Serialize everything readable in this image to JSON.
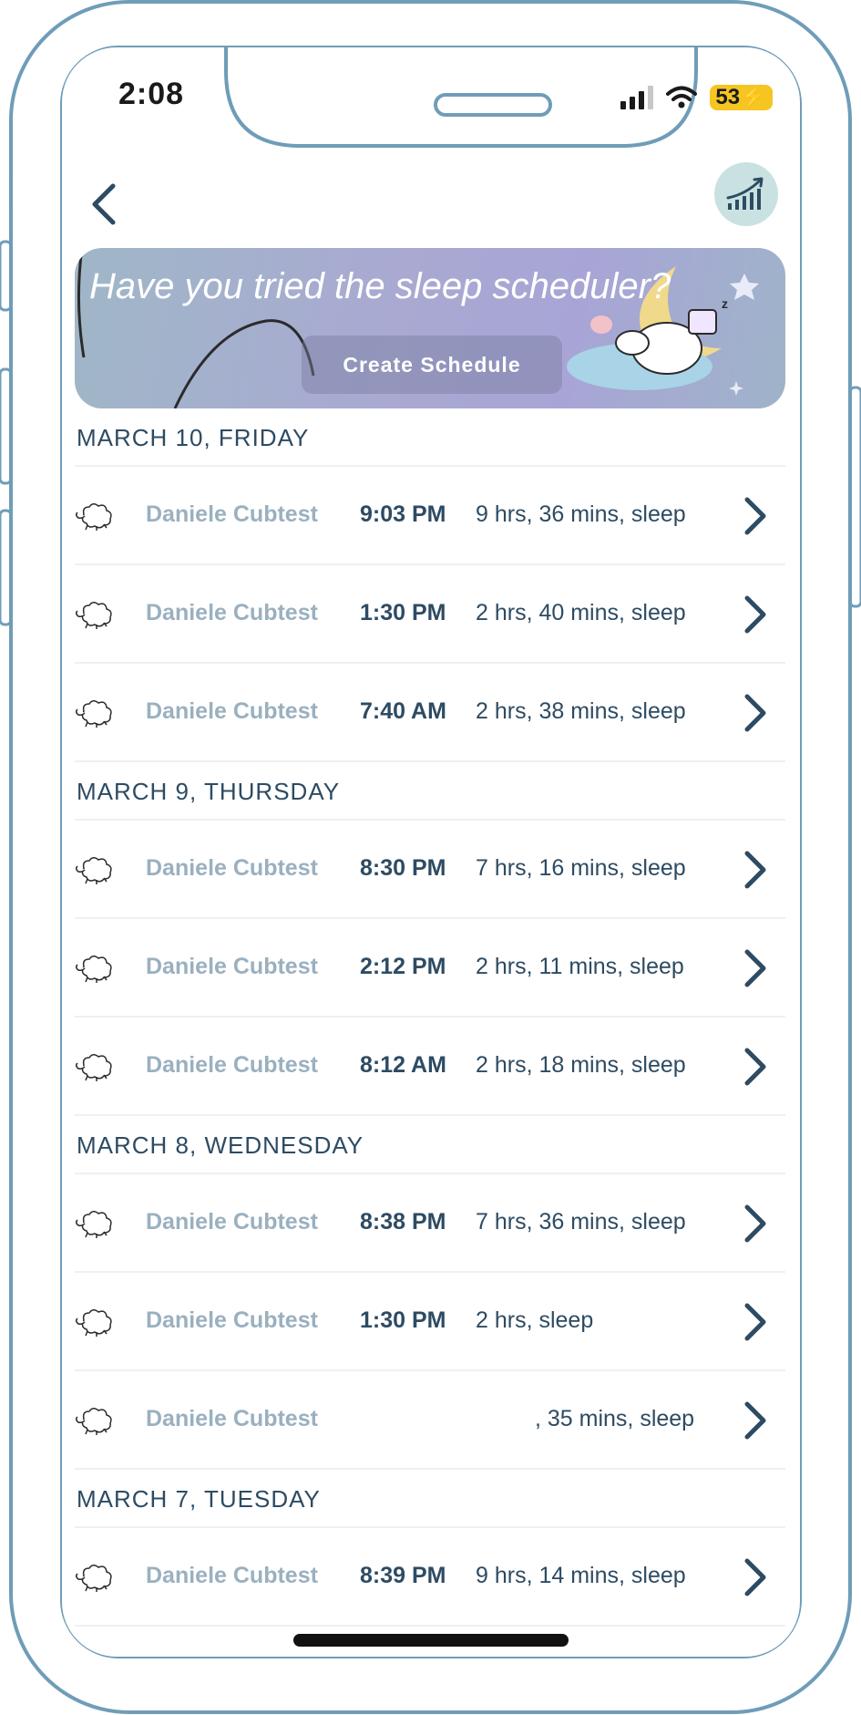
{
  "status_bar": {
    "time": "2:08",
    "battery": "53"
  },
  "banner": {
    "title": "Have you tried the sleep scheduler?",
    "button_label": "Create Schedule"
  },
  "sections": [
    {
      "heading": "MARCH 10, FRIDAY",
      "rows": [
        {
          "name": "Daniele Cubtest",
          "time": "9:03 PM",
          "duration": "9 hrs, 36 mins, sleep"
        },
        {
          "name": "Daniele Cubtest",
          "time": "1:30 PM",
          "duration": "2 hrs, 40 mins, sleep"
        },
        {
          "name": "Daniele Cubtest",
          "time": "7:40 AM",
          "duration": "2 hrs, 38 mins, sleep"
        }
      ]
    },
    {
      "heading": "MARCH 9, THURSDAY",
      "rows": [
        {
          "name": "Daniele Cubtest",
          "time": "8:30 PM",
          "duration": "7 hrs, 16 mins, sleep"
        },
        {
          "name": "Daniele Cubtest",
          "time": "2:12 PM",
          "duration": "2 hrs, 11 mins, sleep"
        },
        {
          "name": "Daniele Cubtest",
          "time": "8:12 AM",
          "duration": "2 hrs, 18 mins, sleep"
        }
      ]
    },
    {
      "heading": "MARCH 8, WEDNESDAY",
      "rows": [
        {
          "name": "Daniele Cubtest",
          "time": "8:38 PM",
          "duration": "7 hrs, 36 mins, sleep"
        },
        {
          "name": "Daniele Cubtest",
          "time": "1:30 PM",
          "duration": "2 hrs, sleep"
        },
        {
          "name": "Daniele Cubtest",
          "time": "",
          "duration": ", 35 mins, sleep"
        }
      ]
    },
    {
      "heading": "MARCH 7, TUESDAY",
      "rows": [
        {
          "name": "Daniele Cubtest",
          "time": "8:39 PM",
          "duration": "9 hrs, 14 mins, sleep"
        }
      ]
    }
  ],
  "colors": {
    "accent": "#2d4b63",
    "muted": "#9ab0bf",
    "frame": "#6f9db8",
    "stats_bg": "#c9e2e1"
  },
  "icons": [
    "back-chevron-icon",
    "stats-chart-icon",
    "sheep-icon",
    "chevron-right-icon",
    "signal-icon",
    "wifi-icon",
    "battery-icon"
  ]
}
